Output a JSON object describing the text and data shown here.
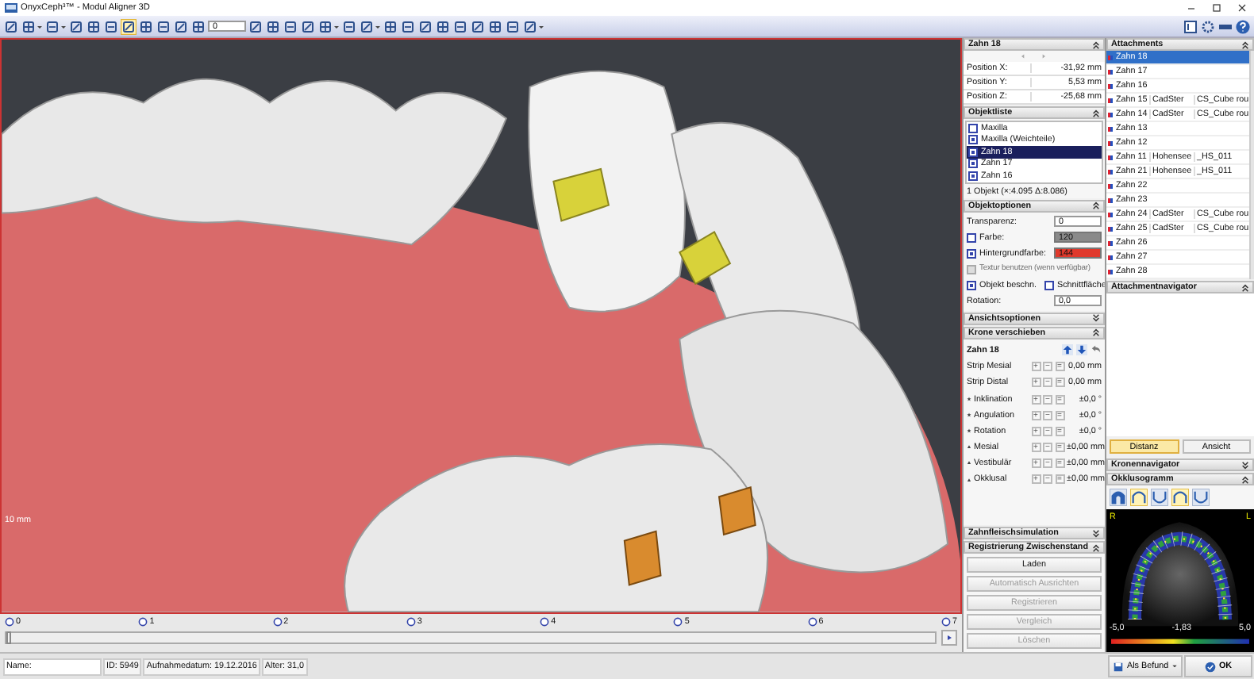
{
  "window": {
    "title": "OnyxCeph³™ - Modul Aligner 3D"
  },
  "toolbar": {
    "tools": [
      {
        "kind": "icon",
        "selected": false
      },
      {
        "kind": "menu",
        "selected": false
      },
      {
        "kind": "menu",
        "selected": false
      },
      {
        "kind": "icon",
        "selected": false
      },
      {
        "kind": "icon",
        "selected": false
      },
      {
        "kind": "icon",
        "selected": false
      },
      {
        "kind": "icon",
        "selected": true
      },
      {
        "kind": "icon",
        "selected": false
      },
      {
        "kind": "icon",
        "selected": false
      },
      {
        "kind": "icon",
        "selected": false
      },
      {
        "kind": "icon",
        "selected": false
      },
      {
        "kind": "spin",
        "selected": false,
        "value": "0"
      },
      {
        "kind": "icon",
        "selected": false
      },
      {
        "kind": "icon",
        "selected": false
      },
      {
        "kind": "icon",
        "selected": false
      },
      {
        "kind": "icon",
        "selected": false
      },
      {
        "kind": "menu",
        "selected": false
      },
      {
        "kind": "icon",
        "selected": false
      },
      {
        "kind": "menu",
        "selected": false
      },
      {
        "kind": "icon",
        "selected": false
      },
      {
        "kind": "icon",
        "selected": false
      },
      {
        "kind": "icon",
        "selected": false
      },
      {
        "kind": "icon",
        "selected": false
      },
      {
        "kind": "icon",
        "selected": false
      },
      {
        "kind": "icon",
        "selected": false
      },
      {
        "kind": "icon",
        "selected": false
      },
      {
        "kind": "icon",
        "selected": false
      },
      {
        "kind": "menu",
        "selected": false
      }
    ]
  },
  "viewport": {
    "scale_label": "10 mm"
  },
  "timeline": {
    "markers": [
      "0",
      "1",
      "2",
      "3",
      "4",
      "5",
      "6",
      "7"
    ],
    "level": 0
  },
  "status_bar": {
    "name_label": "Name:",
    "fields": [
      "ID: 5949",
      "Aufnahmedatum: 19.12.2016",
      "Alter: 31,0"
    ]
  },
  "object_panel": {
    "title": "Zahn 18",
    "expanded": true,
    "fields": [
      {
        "label": "Position X:",
        "value": "-31,92 mm"
      },
      {
        "label": "Position Y:",
        "value": "5,53 mm"
      },
      {
        "label": "Position Z:",
        "value": "-25,68 mm"
      }
    ]
  },
  "object_list": {
    "title": "Objektliste",
    "expanded": true,
    "items": [
      {
        "label": "Maxilla",
        "checked": false,
        "selected": false
      },
      {
        "label": "Maxilla (Weichteile)",
        "checked": true,
        "selected": false
      },
      {
        "label": "Zahn 18",
        "checked": true,
        "selected": true
      },
      {
        "label": "Zahn 17",
        "checked": true,
        "selected": false
      },
      {
        "label": "Zahn 16",
        "checked": true,
        "selected": false
      }
    ],
    "footer": "1 Objekt (×:4.095 Δ:8.086)"
  },
  "object_options": {
    "title": "Objektoptionen",
    "expanded": true,
    "rows": [
      {
        "kind": "spin",
        "label": "Transparenz:",
        "value": "0"
      },
      {
        "kind": "color",
        "label": "Farbe:",
        "checked": false,
        "value": "120",
        "color": "#8a8a8a"
      },
      {
        "kind": "color",
        "label": "Hintergrundfarbe:",
        "checked": true,
        "value": "144",
        "color": "#e0392c"
      },
      {
        "kind": "check",
        "label": "Textur benutzen (wenn verfügbar)",
        "checked": false,
        "disabled": true
      },
      {
        "kind": "pair",
        "items": [
          {
            "label": "Objekt beschn.",
            "checked": true
          },
          {
            "label": "Schnittfläche",
            "checked": false
          }
        ]
      },
      {
        "kind": "spin",
        "label": "Rotation:",
        "value": "0,0"
      }
    ]
  },
  "view_options": {
    "title": "Ansichtsoptionen",
    "expanded": false
  },
  "crown_move": {
    "title": "Krone verschieben",
    "expanded": true,
    "tooth": "Zahn 18",
    "rows": [
      {
        "kind": "strip",
        "label": "Strip Mesial",
        "buttons": [
          "+",
          "−",
          "="
        ],
        "value": "0,00 mm"
      },
      {
        "kind": "strip",
        "label": "Strip Distal",
        "buttons": [
          "+",
          "−",
          "="
        ],
        "value": "0,00 mm"
      },
      {
        "kind": "rotate",
        "label": "Inklination",
        "buttons": [
          "+",
          "−",
          "="
        ],
        "value": "±0,0 °"
      },
      {
        "kind": "rotate",
        "label": "Angulation",
        "buttons": [
          "+",
          "−",
          "="
        ],
        "value": "±0,0 °"
      },
      {
        "kind": "rotate",
        "label": "Rotation",
        "buttons": [
          "+",
          "−",
          "="
        ],
        "value": "±0,0 °"
      },
      {
        "kind": "shift",
        "label": "Mesial",
        "buttons": [
          "+",
          "−",
          "="
        ],
        "value": "±0,00 mm"
      },
      {
        "kind": "shift",
        "label": "Vestibulär",
        "buttons": [
          "+",
          "−",
          "="
        ],
        "value": "±0,00 mm"
      },
      {
        "kind": "shift",
        "label": "Okklusal",
        "buttons": [
          "+",
          "−",
          "="
        ],
        "value": "±0,00 mm"
      }
    ]
  },
  "gum_simulation": {
    "title": "Zahnfleischsimulation",
    "expanded": false
  },
  "registration": {
    "title": "Registrierung Zwischenstand",
    "expanded": true,
    "buttons": [
      {
        "label": "Laden",
        "disabled": false
      },
      {
        "label": "Automatisch Ausrichten",
        "disabled": true
      },
      {
        "label": "Registrieren",
        "disabled": true
      },
      {
        "label": "Vergleich",
        "disabled": true
      },
      {
        "label": "Löschen",
        "disabled": true
      }
    ]
  },
  "attachments": {
    "title": "Attachments",
    "expanded": true,
    "rows": [
      {
        "tooth": "Zahn 18",
        "selected": true
      },
      {
        "tooth": "Zahn 17",
        "selected": false
      },
      {
        "tooth": "Zahn 16",
        "selected": false
      },
      {
        "tooth": "Zahn 15",
        "column_2": "CadSter",
        "column_3": "CS_Cube rou",
        "selected": false
      },
      {
        "tooth": "Zahn 14",
        "column_2": "CadSter",
        "column_3": "CS_Cube rou",
        "selected": false
      },
      {
        "tooth": "Zahn 13",
        "selected": false
      },
      {
        "tooth": "Zahn 12",
        "selected": false
      },
      {
        "tooth": "Zahn 11",
        "column_2": "Hohensee",
        "column_3": "_HS_011",
        "selected": false
      },
      {
        "tooth": "Zahn 21",
        "column_2": "Hohensee",
        "column_3": "_HS_011",
        "selected": false
      },
      {
        "tooth": "Zahn 22",
        "selected": false
      },
      {
        "tooth": "Zahn 23",
        "selected": false
      },
      {
        "tooth": "Zahn 24",
        "column_2": "CadSter",
        "column_3": "CS_Cube rou",
        "selected": false
      },
      {
        "tooth": "Zahn 25",
        "column_2": "CadSter",
        "column_3": "CS_Cube rou",
        "selected": false
      },
      {
        "tooth": "Zahn 26",
        "selected": false
      },
      {
        "tooth": "Zahn 27",
        "selected": false
      },
      {
        "tooth": "Zahn 28",
        "selected": false
      }
    ]
  },
  "attachment_navigator": {
    "title": "Attachmentnavigator",
    "expanded": true,
    "buttons": [
      {
        "label": "Distanz",
        "selected": true
      },
      {
        "label": "Ansicht",
        "selected": false
      }
    ]
  },
  "crown_navigator": {
    "title": "Kronennavigator",
    "expanded": false
  },
  "occlusogram": {
    "title": "Okklusogramm",
    "expanded": true,
    "views": [
      {
        "kind": "filled",
        "selected": false
      },
      {
        "kind": "upper",
        "selected": true
      },
      {
        "kind": "lower",
        "selected": false
      },
      {
        "kind": "upper",
        "selected": true
      },
      {
        "kind": "lower",
        "selected": false
      }
    ],
    "side_labels": [
      "R",
      "L"
    ],
    "scale_labels": [
      "-5,0",
      "-1,83",
      "5,0"
    ]
  },
  "actions": [
    {
      "kind": "menu",
      "label": "Als Befund"
    },
    {
      "kind": "confirm",
      "label": "OK"
    }
  ]
}
